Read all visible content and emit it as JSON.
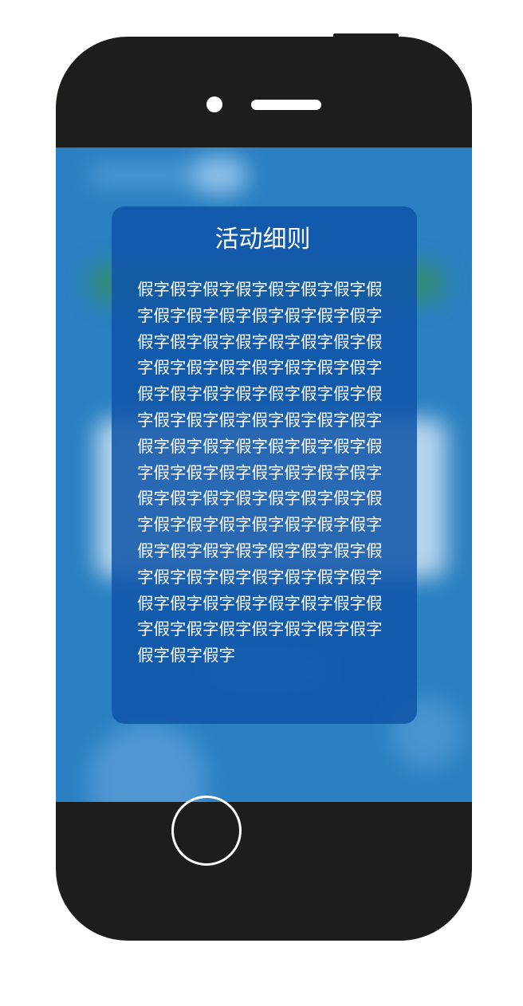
{
  "modal": {
    "title": "活动细则",
    "paragraphs": [
      "假字假字假字假字假字假字假字假字假字假字假字假字假字假字假字假字假字假字假字假字假字假字假字假字假字假字假字假字假字假字假字假字假字假字假字假字假字假字假字假字假字假字假字假字假字假字假字假字假字假字假字假字假字假字假字假字假字假字假字假字",
      "假字假字假字假字假字假字假字假字假字假字假字假字假字假字假字假字假字假字假字假字假字假字假字假字假字假字假字假字假字假字假字假字假字假字假字假字假字假字假字假字假字假字假字假字假字假字假字假字"
    ]
  },
  "colors": {
    "device": "#1d1d1b",
    "screen": "#2a80c2",
    "modal": "#0e54a8",
    "text": "#ffffff"
  }
}
